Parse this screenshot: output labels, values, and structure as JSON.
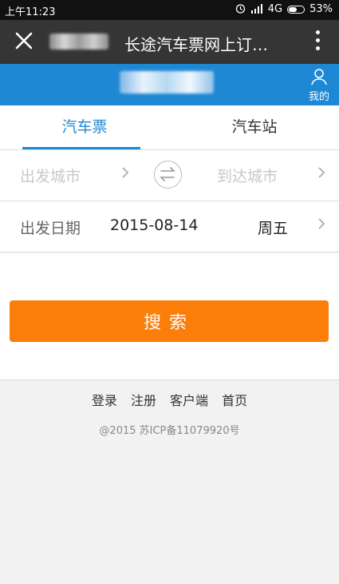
{
  "status_bar": {
    "time": "上午11:23",
    "network": "4G",
    "battery": "53%",
    "icons": [
      "alarm-icon",
      "signal-icon",
      "battery-icon"
    ]
  },
  "wechat_header": {
    "title": "长途汽车票网上订…"
  },
  "account": {
    "mine_label": "我的"
  },
  "tabs": [
    {
      "label": "汽车票",
      "active": true
    },
    {
      "label": "汽车站",
      "active": false
    }
  ],
  "route": {
    "from_placeholder": "出发城市",
    "to_placeholder": "到达城市"
  },
  "date_row": {
    "label": "出发日期",
    "date": "2015-08-14",
    "weekday": "周五"
  },
  "search_label": "搜索",
  "footer": {
    "links": [
      "登录",
      "注册",
      "客户端",
      "首页"
    ],
    "copyright": "@2015 苏ICP备11079920号"
  },
  "colors": {
    "accent_blue": "#1e88d4",
    "search_orange": "#fb7d0a",
    "header_dark": "#353535"
  }
}
